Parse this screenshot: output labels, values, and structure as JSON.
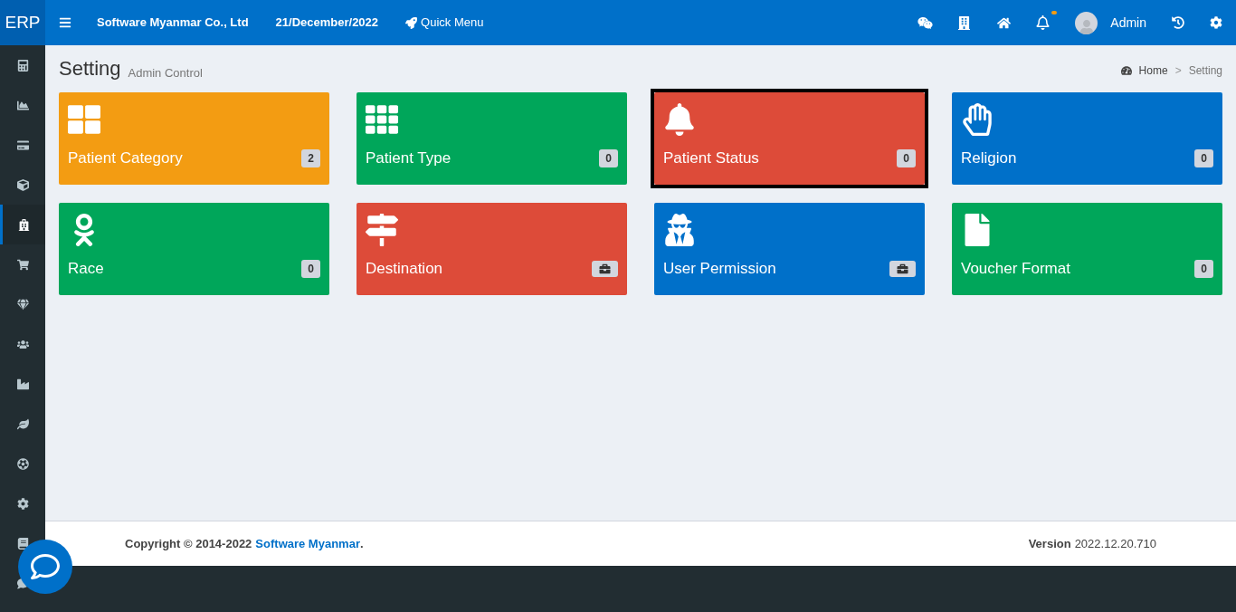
{
  "header": {
    "logo": "ERP",
    "company": "Software Myanmar Co., Ltd",
    "date": "21/December/2022",
    "quick_menu": "Quick Menu",
    "notification_dot": true,
    "user": "Admin"
  },
  "sidebar": {
    "items": [
      {
        "selected": false
      },
      {
        "selected": false
      },
      {
        "selected": false
      },
      {
        "selected": false
      },
      {
        "selected": true
      },
      {
        "selected": false
      },
      {
        "selected": false
      },
      {
        "selected": false
      },
      {
        "selected": false
      },
      {
        "selected": false
      },
      {
        "selected": false
      },
      {
        "selected": false
      },
      {
        "selected": false
      },
      {
        "selected": false
      }
    ]
  },
  "page": {
    "title": "Setting",
    "subtitle": "Admin Control"
  },
  "breadcrumb": [
    {
      "label": "Home"
    },
    {
      "label": "Setting"
    }
  ],
  "breadcrumb_separator": ">",
  "tiles": [
    {
      "label": "Patient Category",
      "color": "#f39c12",
      "badge": {
        "kind": "count",
        "text": "2"
      },
      "highlighted": false
    },
    {
      "label": "Patient Type",
      "color": "#00a65a",
      "badge": {
        "kind": "count",
        "text": "0"
      },
      "highlighted": false
    },
    {
      "label": "Patient Status",
      "color": "#dd4b39",
      "badge": {
        "kind": "count",
        "text": "0"
      },
      "highlighted": true
    },
    {
      "label": "Religion",
      "color": "#0070c9",
      "badge": {
        "kind": "count",
        "text": "0"
      },
      "highlighted": false
    },
    {
      "label": "Race",
      "color": "#00a65a",
      "badge": {
        "kind": "count",
        "text": "0"
      },
      "highlighted": false
    },
    {
      "label": "Destination",
      "color": "#dd4b39",
      "badge": {
        "kind": "icon"
      },
      "highlighted": false
    },
    {
      "label": "User Permission",
      "color": "#0070c9",
      "badge": {
        "kind": "icon"
      },
      "highlighted": false
    },
    {
      "label": "Voucher Format",
      "color": "#00a65a",
      "badge": {
        "kind": "count",
        "text": "0"
      },
      "highlighted": false
    }
  ],
  "footer": {
    "copyright": "Copyright © 2014-2022",
    "link": "Software Myanmar",
    "suffix": ".",
    "version_label": "Version",
    "version": "2022.12.20.710"
  }
}
